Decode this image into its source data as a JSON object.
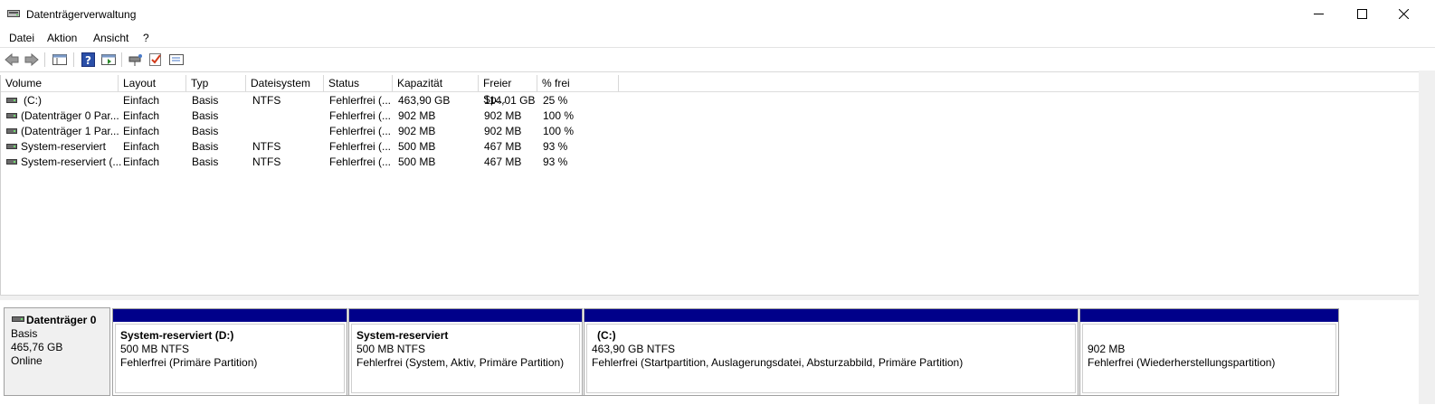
{
  "window": {
    "title": "Datenträgerverwaltung",
    "controls": {
      "minimize": "—",
      "maximize": "☐",
      "close": "✕"
    }
  },
  "menu": [
    "Datei",
    "Aktion",
    "Ansicht",
    "?"
  ],
  "toolbar": {
    "icons": [
      "back-icon",
      "forward-icon",
      "show-hide-console-tree-icon",
      "help-icon",
      "show-hide-action-pane-icon",
      "connect-drive-icon",
      "check-icon",
      "properties-icon"
    ]
  },
  "volume_table": {
    "columns": [
      "Volume",
      "Layout",
      "Typ",
      "Dateisystem",
      "Status",
      "Kapazität",
      "Freier Sp...",
      "% frei"
    ],
    "rows": [
      [
        "(C:)",
        "Einfach",
        "Basis",
        "NTFS",
        "Fehlerfrei (...",
        "463,90 GB",
        "114,01 GB",
        "25 %"
      ],
      [
        "(Datenträger 0 Par...",
        "Einfach",
        "Basis",
        "",
        "Fehlerfrei (...",
        "902 MB",
        "902 MB",
        "100 %"
      ],
      [
        "(Datenträger 1 Par...",
        "Einfach",
        "Basis",
        "",
        "Fehlerfrei (...",
        "902 MB",
        "902 MB",
        "100 %"
      ],
      [
        "System-reserviert",
        "Einfach",
        "Basis",
        "NTFS",
        "Fehlerfrei (...",
        "500 MB",
        "467 MB",
        "93 %"
      ],
      [
        "System-reserviert (...",
        "Einfach",
        "Basis",
        "NTFS",
        "Fehlerfrei (...",
        "500 MB",
        "467 MB",
        "93 %"
      ]
    ]
  },
  "disk": {
    "name": "Datenträger 0",
    "type": "Basis",
    "size": "465,76 GB",
    "state": "Online",
    "partitions": [
      {
        "title": "System-reserviert  (D:)",
        "size": "500 MB NTFS",
        "status": "Fehlerfrei (Primäre Partition)"
      },
      {
        "title": "System-reserviert",
        "size": "500 MB NTFS",
        "status": "Fehlerfrei (System, Aktiv, Primäre Partition)"
      },
      {
        "title": "(C:)",
        "size": "463,90 GB NTFS",
        "status": "Fehlerfrei (Startpartition, Auslagerungsdatei, Absturzabbild, Primäre Partition)"
      },
      {
        "title": "",
        "size": "902 MB",
        "status": "Fehlerfrei (Wiederherstellungspartition)"
      }
    ]
  },
  "colors": {
    "partition_header": "#00008a",
    "pane_gray": "#f0f0f0"
  }
}
